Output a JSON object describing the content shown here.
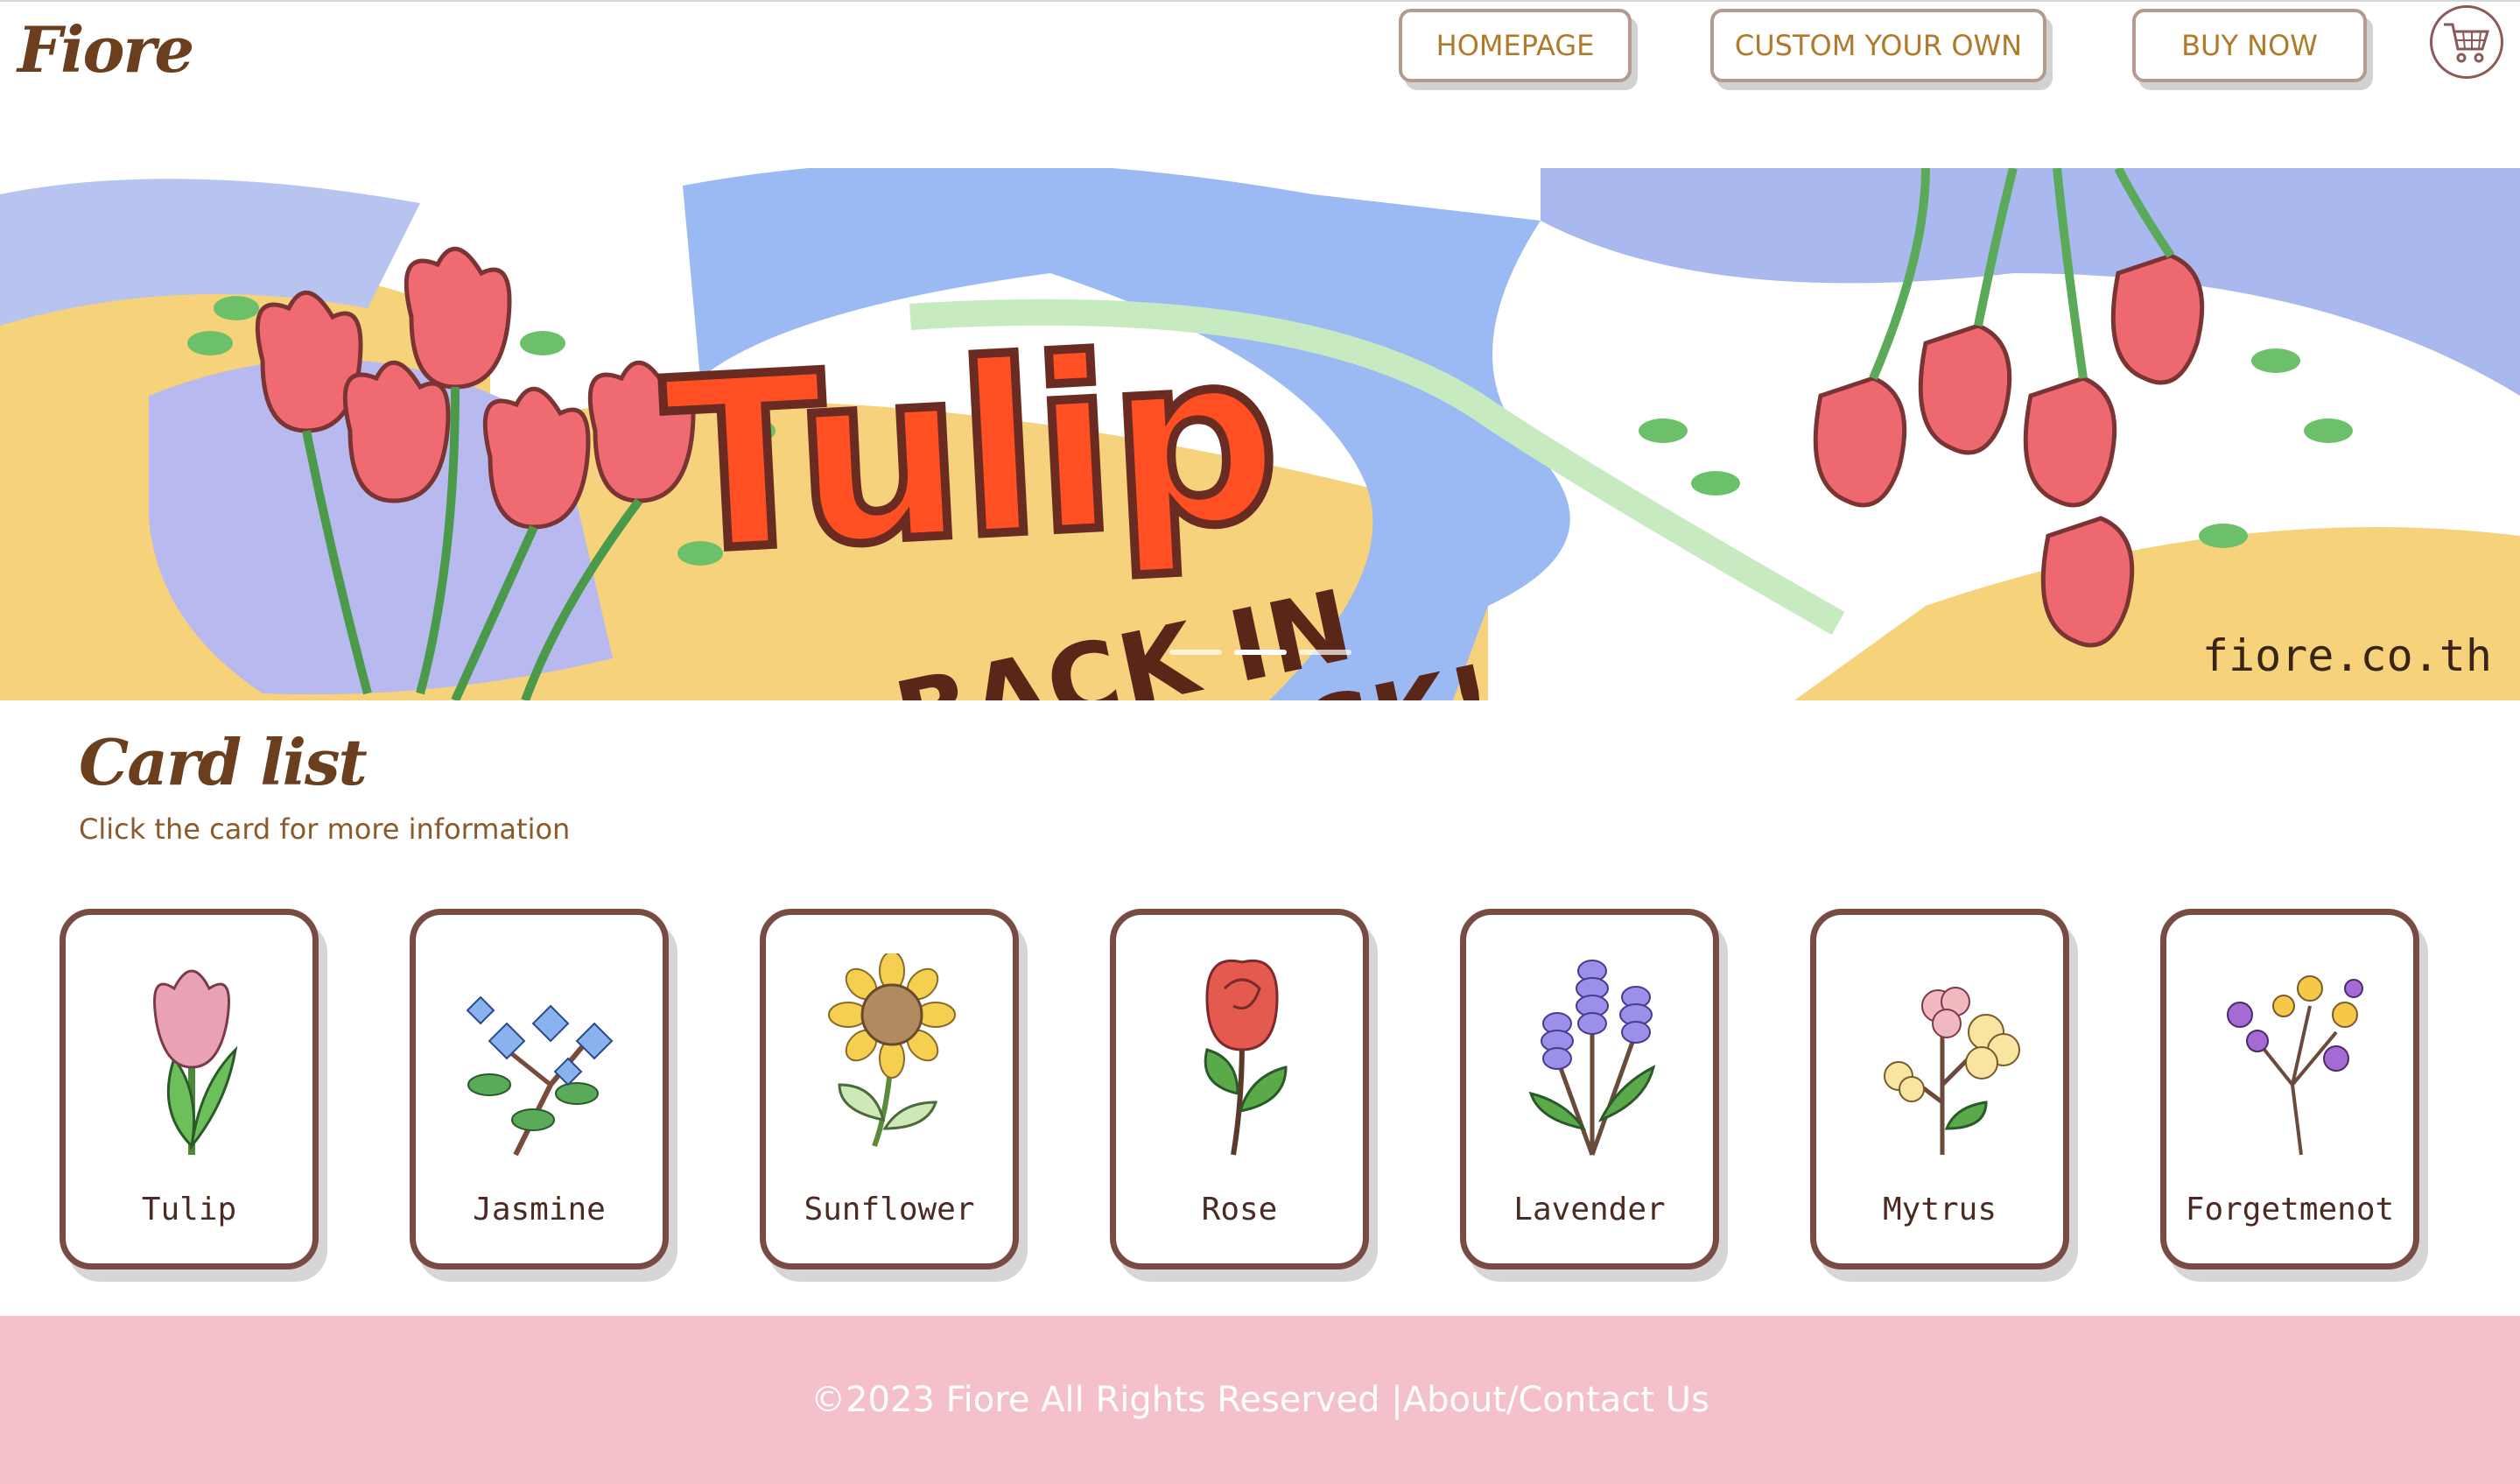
{
  "header": {
    "logo": "Fiore",
    "nav": [
      {
        "label": "HOMEPAGE"
      },
      {
        "label": "CUSTOM YOUR OWN"
      },
      {
        "label": "BUY NOW"
      }
    ],
    "cart_icon": "shopping-cart-icon"
  },
  "banner": {
    "title": "Tulip",
    "subtitle_line1": "BACK IN",
    "subtitle_line2": "STOCK!",
    "brand": "fiore.co.th",
    "slides": 3,
    "active_slide": 2
  },
  "card_section": {
    "title": "Card list",
    "subtitle": "Click the card for more information"
  },
  "cards": [
    {
      "label": "Tulip",
      "icon": "tulip-icon"
    },
    {
      "label": "Jasmine",
      "icon": "jasmine-icon"
    },
    {
      "label": "Sunflower",
      "icon": "sunflower-icon"
    },
    {
      "label": "Rose",
      "icon": "rose-icon"
    },
    {
      "label": "Lavender",
      "icon": "lavender-icon"
    },
    {
      "label": "Mytrus",
      "icon": "mytrus-icon"
    },
    {
      "label": "Forgetmenot",
      "icon": "forgetmenot-icon"
    }
  ],
  "footer": {
    "copyright": "©2023 Fiore All Rights Reserved | ",
    "about": "About",
    "separator": " / ",
    "contact": "Contact Us"
  },
  "colors": {
    "brand_brown": "#6b3f1e",
    "nav_text": "#b17a2a",
    "footer_bg": "#f4c0ca",
    "banner_title": "#ff4f23"
  }
}
